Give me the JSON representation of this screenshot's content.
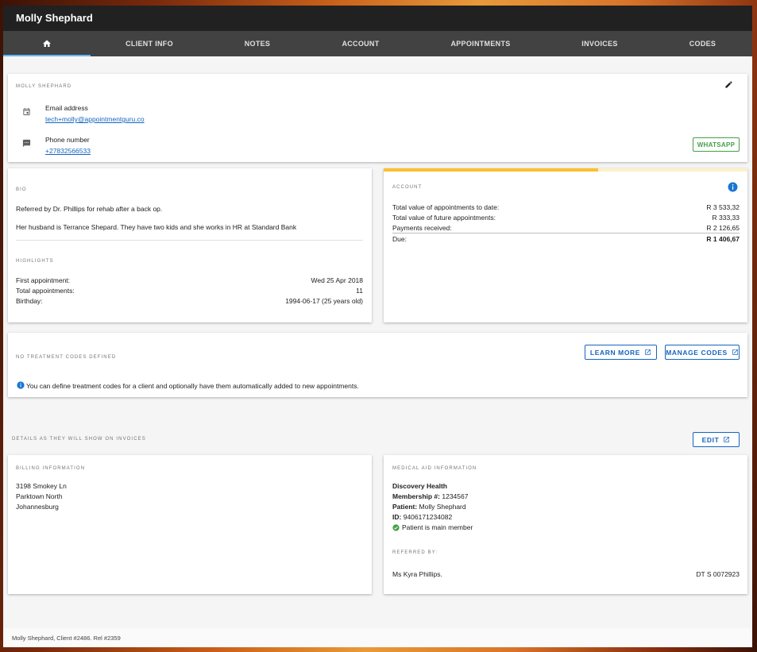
{
  "window": {
    "title": "Molly Shephard"
  },
  "tabs": [
    {
      "label": "",
      "icon": "home-icon"
    },
    {
      "label": "CLIENT INFO"
    },
    {
      "label": "NOTES"
    },
    {
      "label": "ACCOUNT"
    },
    {
      "label": "APPOINTMENTS"
    },
    {
      "label": "INVOICES"
    },
    {
      "label": "CODES"
    }
  ],
  "contact": {
    "name_overline": "MOLLY SHEPHARD",
    "email_label": "Email address",
    "email_value": "tech+molly@appointmentguru.co",
    "phone_label": "Phone number",
    "phone_value": "+27832566533",
    "whatsapp_label": "WHATSAPP"
  },
  "bio": {
    "overline": "BIO",
    "line1": "Referred by Dr. Phillips for rehab after a back op.",
    "line2": "Her husband is Terrance Shepard. They have two kids and she works in HR at Standard Bank",
    "highlights_overline": "HIGHLIGHTS",
    "highlights": [
      {
        "label": "First appointment:",
        "value": "Wed 25 Apr 2018"
      },
      {
        "label": "Total appointments:",
        "value": "11"
      },
      {
        "label": "Birthday:",
        "value": "1994-06-17 (25 years old)"
      }
    ]
  },
  "account": {
    "overline": "ACCOUNT",
    "progress": 0.59,
    "rows": [
      {
        "label": "Total value of appointments to date:",
        "value": "R 3 533,32"
      },
      {
        "label": "Total value of future appointments:",
        "value": "R 333,33"
      },
      {
        "label": "Payments received:",
        "value": "R 2 126,65"
      },
      {
        "label": "Due:",
        "value": "R 1 406,67"
      }
    ]
  },
  "codes": {
    "overline": "NO TREATMENT CODES DEFINED",
    "learn_more": "LEARN MORE",
    "manage_codes": "MANAGE CODES",
    "info": "You can define treatment codes for a client and optionally have them automatically added to new appointments."
  },
  "invoice_details": {
    "overline": "DETAILS AS THEY WILL SHOW ON INVOICES",
    "edit_label": "EDIT"
  },
  "billing": {
    "overline": "BILLING INFORMATION",
    "lines": [
      "3198 Smokey Ln",
      "Parktown North",
      "Johannesburg"
    ]
  },
  "medical": {
    "overline": "MEDICAL AID INFORMATION",
    "scheme": "Discovery Health",
    "membership_label": "Membership #:",
    "membership_value": "1234567",
    "patient_label": "Patient:",
    "patient_value": "Molly Shephard",
    "id_label": "ID:",
    "id_value": "9406171234082",
    "main_member": "Patient is main member",
    "referred_overline": "REFERRED BY:",
    "referrer_name": "Ms Kyra Phillips.",
    "referrer_code": "DT S 0072923"
  },
  "footer": {
    "text": "Molly Shephard, Client #2486. Rel #2359"
  },
  "colors": {
    "accent": "#1565c0",
    "progress_fill": "#fbc02d",
    "progress_track": "#fff0c7",
    "success": "#43a047"
  }
}
